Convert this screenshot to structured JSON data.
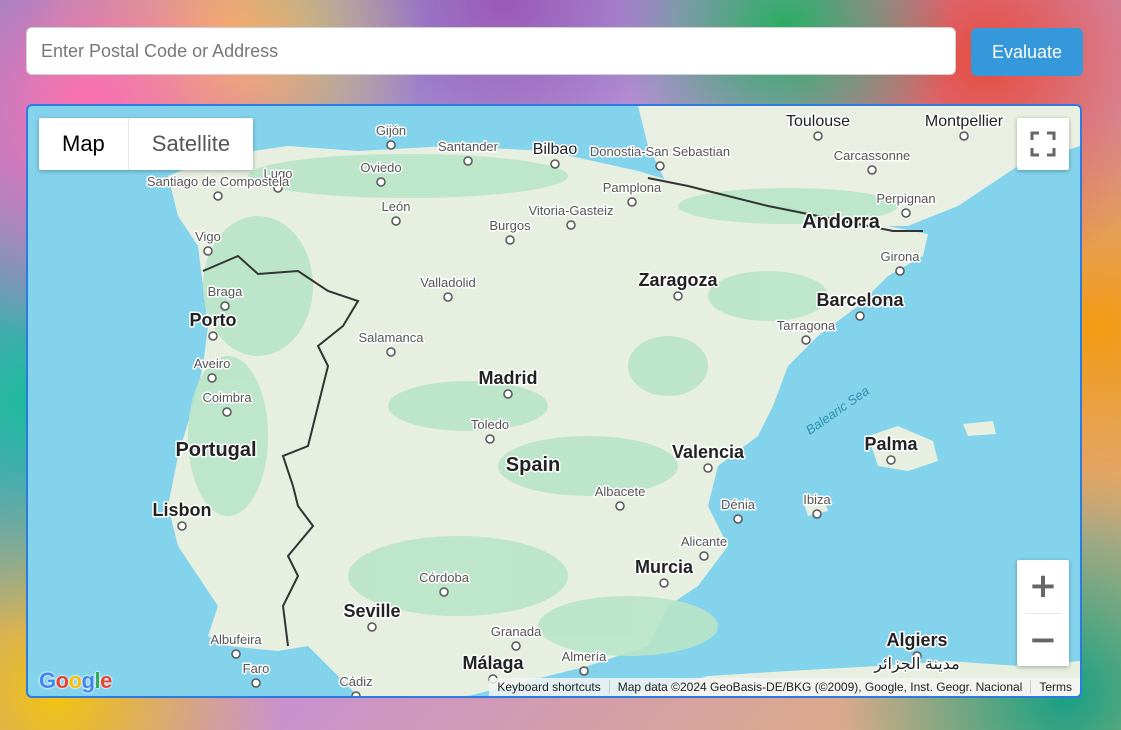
{
  "search": {
    "placeholder": "Enter Postal Code or Address",
    "value": ""
  },
  "evaluate_label": "Evaluate",
  "map": {
    "type_options": [
      "Map",
      "Satellite"
    ],
    "selected_type": "Map",
    "zoom_in_label": "+",
    "zoom_out_label": "−",
    "google_logo": "Google",
    "attribution": {
      "shortcuts": "Keyboard shortcuts",
      "data": "Map data ©2024 GeoBasis-DE/BKG (©2009), Google, Inst. Geogr. Nacional",
      "terms": "Terms"
    },
    "colors": {
      "water": "#83d3ec",
      "land": "#e8f0e0",
      "forest": "#b8e3c4",
      "border": "#333333"
    },
    "countries": [
      "Portugal",
      "Spain",
      "Andorra"
    ],
    "sea_label": "Balearic Sea",
    "cities": [
      {
        "name": "Toulouse",
        "cls": "mid"
      },
      {
        "name": "Montpellier",
        "cls": "mid"
      },
      {
        "name": "Carcassonne",
        "cls": "small"
      },
      {
        "name": "Perpignan",
        "cls": "small"
      },
      {
        "name": "Gijón",
        "cls": "small"
      },
      {
        "name": "Santander",
        "cls": "small"
      },
      {
        "name": "Bilbao",
        "cls": "mid"
      },
      {
        "name": "Donostia-San Sebastian",
        "cls": "small"
      },
      {
        "name": "Oviedo",
        "cls": "small"
      },
      {
        "name": "Lugo",
        "cls": "small"
      },
      {
        "name": "Santiago de Compostela",
        "cls": "small"
      },
      {
        "name": "Pamplona",
        "cls": "small"
      },
      {
        "name": "León",
        "cls": "small"
      },
      {
        "name": "Vitoria-Gasteiz",
        "cls": "small"
      },
      {
        "name": "Burgos",
        "cls": "small"
      },
      {
        "name": "Vigo",
        "cls": "small"
      },
      {
        "name": "Girona",
        "cls": "small"
      },
      {
        "name": "Braga",
        "cls": "small"
      },
      {
        "name": "Valladolid",
        "cls": "small"
      },
      {
        "name": "Zaragoza",
        "cls": "big"
      },
      {
        "name": "Barcelona",
        "cls": "big"
      },
      {
        "name": "Porto",
        "cls": "big"
      },
      {
        "name": "Tarragona",
        "cls": "small"
      },
      {
        "name": "Salamanca",
        "cls": "small"
      },
      {
        "name": "Aveiro",
        "cls": "small"
      },
      {
        "name": "Madrid",
        "cls": "big"
      },
      {
        "name": "Coimbra",
        "cls": "small"
      },
      {
        "name": "Toledo",
        "cls": "small"
      },
      {
        "name": "Palma",
        "cls": "big"
      },
      {
        "name": "Valencia",
        "cls": "big"
      },
      {
        "name": "Albacete",
        "cls": "small"
      },
      {
        "name": "Lisbon",
        "cls": "big"
      },
      {
        "name": "Dénia",
        "cls": "small"
      },
      {
        "name": "Ibiza",
        "cls": "small"
      },
      {
        "name": "Alicante",
        "cls": "small"
      },
      {
        "name": "Córdoba",
        "cls": "small"
      },
      {
        "name": "Murcia",
        "cls": "big"
      },
      {
        "name": "Seville",
        "cls": "big"
      },
      {
        "name": "Albufeira",
        "cls": "small"
      },
      {
        "name": "Granada",
        "cls": "small"
      },
      {
        "name": "Algiers",
        "cls": "big"
      },
      {
        "name": "مدينة الجزائر",
        "cls": "mid"
      },
      {
        "name": "Almería",
        "cls": "small"
      },
      {
        "name": "Faro",
        "cls": "small"
      },
      {
        "name": "Málaga",
        "cls": "big"
      },
      {
        "name": "Cádiz",
        "cls": "small"
      }
    ]
  }
}
